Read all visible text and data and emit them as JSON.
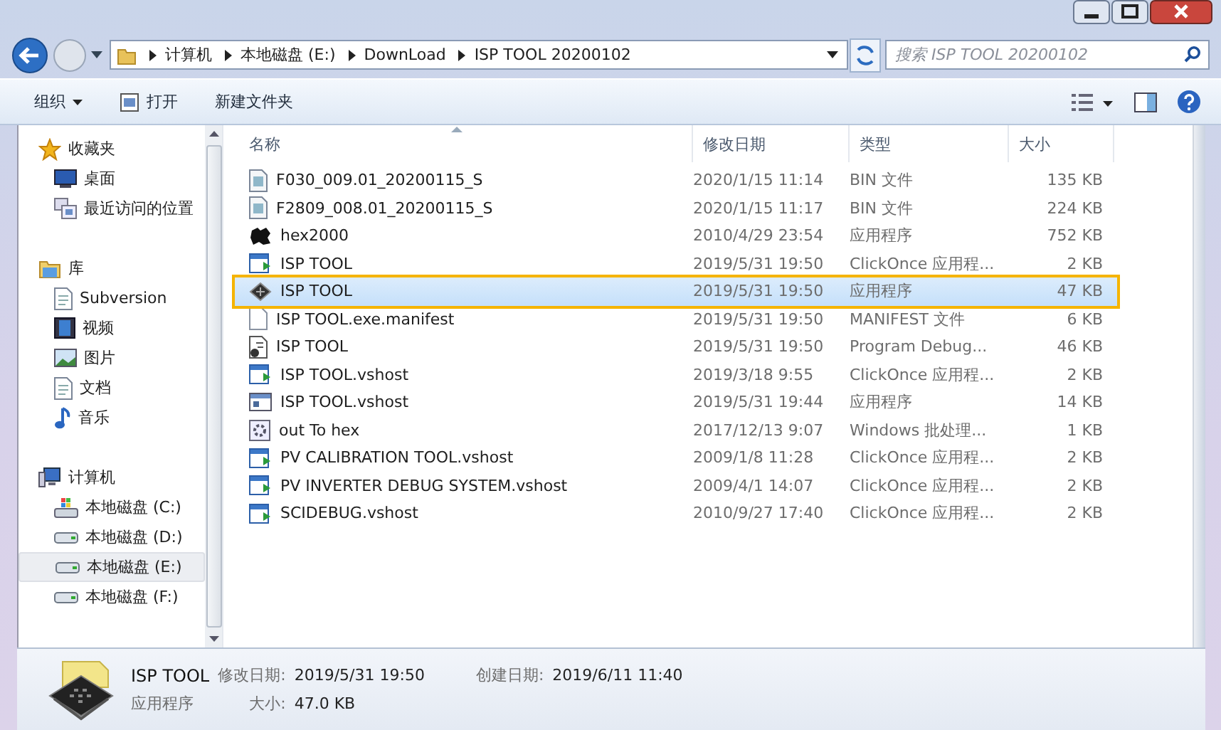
{
  "address": {
    "crumbs": [
      "计算机",
      "本地磁盘 (E:)",
      "DownLoad",
      "ISP TOOL 20200102"
    ]
  },
  "search": {
    "placeholder": "搜索 ISP TOOL 20200102"
  },
  "toolbar": {
    "buttons": [
      {
        "label": "组织",
        "kind": "menu"
      },
      {
        "label": "打开",
        "kind": "icon"
      },
      {
        "label": "新建文件夹",
        "kind": "plain"
      }
    ]
  },
  "sidebar": {
    "groups": [
      {
        "label": "收藏夹",
        "kind": "star",
        "selected": false,
        "children": [
          {
            "label": "桌面",
            "kind": "desktop",
            "selected": false
          },
          {
            "label": "最近访问的位置",
            "kind": "recent",
            "selected": false
          }
        ]
      },
      {
        "label": "库",
        "kind": "library",
        "selected": false,
        "children": [
          {
            "label": "Subversion",
            "kind": "doc",
            "selected": false
          },
          {
            "label": "视频",
            "kind": "video",
            "selected": false
          },
          {
            "label": "图片",
            "kind": "picture",
            "selected": false
          },
          {
            "label": "文档",
            "kind": "doc",
            "selected": false
          },
          {
            "label": "音乐",
            "kind": "music",
            "selected": false
          }
        ]
      },
      {
        "label": "计算机",
        "kind": "computer",
        "selected": false,
        "children": [
          {
            "label": "本地磁盘 (C:)",
            "kind": "windrive",
            "selected": false
          },
          {
            "label": "本地磁盘 (D:)",
            "kind": "drive",
            "selected": false
          },
          {
            "label": "本地磁盘 (E:)",
            "kind": "drive",
            "selected": true
          },
          {
            "label": "本地磁盘 (F:)",
            "kind": "drive",
            "selected": false
          }
        ]
      }
    ]
  },
  "table": {
    "columns": [
      "名称",
      "修改日期",
      "类型",
      "大小"
    ],
    "rows": [
      {
        "name": "F030_009.01_20200115_S",
        "date": "2020/1/15 11:14",
        "type": "BIN 文件",
        "size": "135 KB",
        "kind": "bin",
        "selected": false
      },
      {
        "name": "F2809_008.01_20200115_S",
        "date": "2020/1/15 11:17",
        "type": "BIN 文件",
        "size": "224 KB",
        "kind": "bin",
        "selected": false
      },
      {
        "name": "hex2000",
        "date": "2010/4/29 23:54",
        "type": "应用程序",
        "size": "752 KB",
        "kind": "hex",
        "selected": false
      },
      {
        "name": "ISP TOOL",
        "date": "2019/5/31 19:50",
        "type": "ClickOnce 应用程...",
        "size": "2 KB",
        "kind": "clickonce",
        "selected": false
      },
      {
        "name": "ISP TOOL",
        "date": "2019/5/31 19:50",
        "type": "应用程序",
        "size": "47 KB",
        "kind": "chip",
        "selected": true
      },
      {
        "name": "ISP TOOL.exe.manifest",
        "date": "2019/5/31 19:50",
        "type": "MANIFEST 文件",
        "size": "6 KB",
        "kind": "blank",
        "selected": false
      },
      {
        "name": "ISP TOOL",
        "date": "2019/5/31 19:50",
        "type": "Program Debug...",
        "size": "46 KB",
        "kind": "pdb",
        "selected": false
      },
      {
        "name": "ISP TOOL.vshost",
        "date": "2019/3/18 9:55",
        "type": "ClickOnce 应用程...",
        "size": "2 KB",
        "kind": "clickonce",
        "selected": false
      },
      {
        "name": "ISP TOOL.vshost",
        "date": "2019/5/31 19:44",
        "type": "应用程序",
        "size": "14 KB",
        "kind": "window",
        "selected": false
      },
      {
        "name": "out To hex",
        "date": "2017/12/13 9:07",
        "type": "Windows 批处理...",
        "size": "1 KB",
        "kind": "batch",
        "selected": false
      },
      {
        "name": "PV CALIBRATION TOOL.vshost",
        "date": "2009/1/8 11:28",
        "type": "ClickOnce 应用程...",
        "size": "2 KB",
        "kind": "clickonce",
        "selected": false
      },
      {
        "name": "PV INVERTER DEBUG SYSTEM.vshost",
        "date": "2009/4/1 14:07",
        "type": "ClickOnce 应用程...",
        "size": "2 KB",
        "kind": "clickonce",
        "selected": false
      },
      {
        "name": "SCIDEBUG.vshost",
        "date": "2010/9/27 17:40",
        "type": "ClickOnce 应用程...",
        "size": "2 KB",
        "kind": "clickonce",
        "selected": false
      }
    ]
  },
  "details": {
    "name": "ISP TOOL",
    "type": "应用程序",
    "modified_label": "修改日期:",
    "modified": "2019/5/31 19:50",
    "created_label": "创建日期:",
    "created": "2019/6/11 11:40",
    "size_label": "大小:",
    "size": "47.0 KB"
  }
}
